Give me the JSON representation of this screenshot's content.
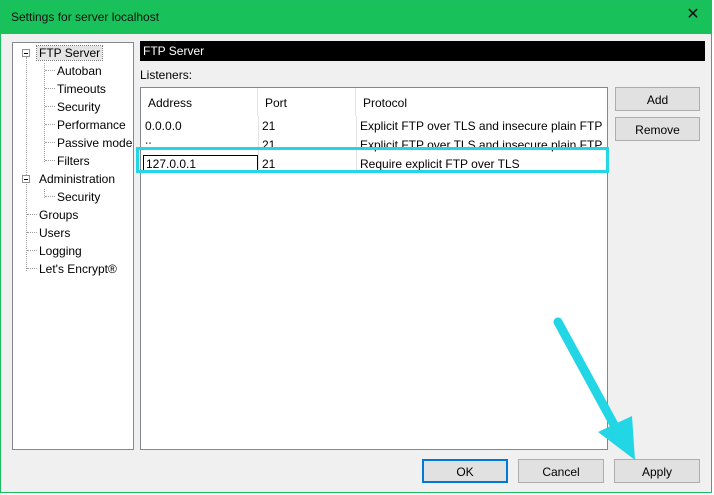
{
  "window": {
    "title": "Settings for server localhost"
  },
  "tree": {
    "items": [
      {
        "label": "FTP Server"
      },
      {
        "label": "Autoban"
      },
      {
        "label": "Timeouts"
      },
      {
        "label": "Security"
      },
      {
        "label": "Performance"
      },
      {
        "label": "Passive mode"
      },
      {
        "label": "Filters"
      },
      {
        "label": "Administration"
      },
      {
        "label": "Security"
      },
      {
        "label": "Groups"
      },
      {
        "label": "Users"
      },
      {
        "label": "Logging"
      },
      {
        "label": "Let's Encrypt®"
      }
    ]
  },
  "panel": {
    "header": "FTP Server",
    "listeners_label": "Listeners:",
    "columns": [
      "Address",
      "Port",
      "Protocol"
    ],
    "rows": [
      {
        "address": "0.0.0.0",
        "port": "21",
        "protocol": "Explicit FTP over TLS and insecure plain FTP"
      },
      {
        "address": "::",
        "port": "21",
        "protocol": "Explicit FTP over TLS and insecure plain FTP"
      },
      {
        "address": "127.0.0.1",
        "port": "21",
        "protocol": "Require explicit FTP over TLS"
      }
    ],
    "add_label": "Add",
    "remove_label": "Remove"
  },
  "footer": {
    "ok_label": "OK",
    "cancel_label": "Cancel",
    "apply_label": "Apply"
  },
  "colors": {
    "titlebar": "#19c15a",
    "highlight": "#22d6e6",
    "arrow": "#22d6e6"
  }
}
